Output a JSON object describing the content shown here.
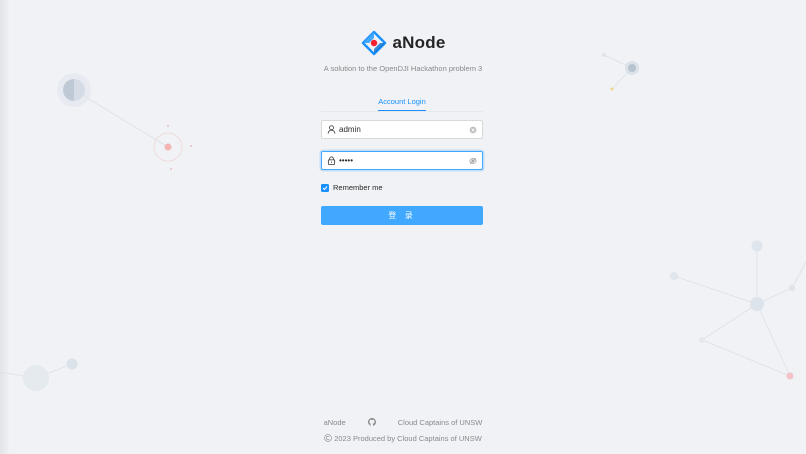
{
  "app": {
    "title": "aNode",
    "description": "A solution to the OpenDJI Hackathon problem 3"
  },
  "tabs": [
    {
      "label": "Account Login",
      "active": true
    }
  ],
  "form": {
    "username": {
      "value": "admin",
      "icon": "user-icon",
      "clear_icon": "clear-icon"
    },
    "password": {
      "value": "•••••",
      "icon": "lock-icon",
      "toggle_icon": "eye-invisible-icon"
    },
    "remember": {
      "label": "Remember me",
      "checked": true
    },
    "submit_label": "登 录"
  },
  "footer": {
    "links": [
      {
        "label": "aNode"
      },
      {
        "icon": "github-icon"
      },
      {
        "label": "Cloud Captains of UNSW"
      }
    ],
    "copyright_icon": "copyright-icon",
    "copyright": "2023 Produced by Cloud Captains of UNSW"
  },
  "colors": {
    "primary": "#1890ff",
    "button": "#40a9ff",
    "background": "#f0f2f5"
  }
}
